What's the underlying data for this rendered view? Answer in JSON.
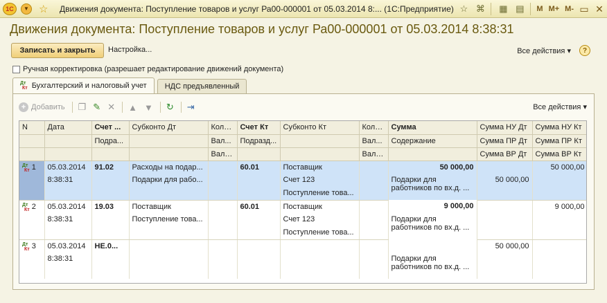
{
  "window": {
    "title": "Движения документа: Поступление товаров и услуг Ра00-000001 от 05.03.2014 8:... (1С:Предприятие)",
    "logo_text": "1С",
    "tb_m": "M",
    "tb_mplus": "M+",
    "tb_mminus": "M-"
  },
  "form": {
    "title": "Движения документа: Поступление товаров и услуг Ра00-000001 от 05.03.2014 8:38:31",
    "save_close_label": "Записать и закрыть",
    "settings_label": "Настройка...",
    "all_actions_label": "Все действия",
    "help_label": "?",
    "manual_adjust_label": "Ручная корректировка (разрешает редактирование движений документа)"
  },
  "tabs": [
    {
      "label": "Бухгалтерский и налоговый учет"
    },
    {
      "label": "НДС предъявленный"
    }
  ],
  "toolbar": {
    "add_label": "Добавить",
    "all_actions_label": "Все действия"
  },
  "table": {
    "headers": {
      "row1": [
        "N",
        "Дата",
        "Счет ...",
        "Субконто Дт",
        "Коли...",
        "Счет Кт",
        "Субконто Кт",
        "Коли...",
        "Сумма",
        "Сумма НУ Дт",
        "Сумма НУ Кт"
      ],
      "row2": [
        "",
        "",
        "Подра...",
        "",
        "Вал...",
        "Подразд...",
        "",
        "Вал...",
        "Содержание",
        "Сумма ПР Дт",
        "Сумма ПР Кт"
      ],
      "row3": [
        "",
        "",
        "",
        "",
        "Вал. ...",
        "",
        "",
        "Вал. ...",
        "",
        "Сумма ВР Дт",
        "Сумма ВР Кт"
      ]
    },
    "rows": [
      {
        "n": "1",
        "date": "05.03.2014",
        "time": "8:38:31",
        "account_dt": "91.02",
        "subconto_dt_1": "Расходы на подар...",
        "subconto_dt_2": "Подарки для рабо...",
        "account_kt": "60.01",
        "subconto_kt_1": "Поставщик",
        "subconto_kt_2": "Счет 123",
        "subconto_kt_3": "Поступление това...",
        "sum": "50 000,00",
        "content": "Подарки для работников по вх.д. ...",
        "nu_dt": "",
        "nu_kt": "50 000,00",
        "pr_dt": "50 000,00",
        "pr_kt": "",
        "vr_dt": "",
        "vr_kt": ""
      },
      {
        "n": "2",
        "date": "05.03.2014",
        "time": "8:38:31",
        "account_dt": "19.03",
        "subconto_dt_1": "Поставщик",
        "subconto_dt_2": "Поступление това...",
        "account_kt": "60.01",
        "subconto_kt_1": "Поставщик",
        "subconto_kt_2": "Счет 123",
        "subconto_kt_3": "Поступление това...",
        "sum": "9 000,00",
        "content": "Подарки для работников по вх.д. ...",
        "nu_dt": "",
        "nu_kt": "9 000,00",
        "pr_dt": "",
        "pr_kt": "",
        "vr_dt": "",
        "vr_kt": ""
      },
      {
        "n": "3",
        "date": "05.03.2014",
        "time": "8:38:31",
        "account_dt": "НЕ.0...",
        "subconto_dt_1": "",
        "subconto_dt_2": "",
        "account_kt": "",
        "subconto_kt_1": "",
        "subconto_kt_2": "",
        "subconto_kt_3": "",
        "sum": "",
        "content": "Подарки для работников по вх.д. ...",
        "nu_dt": "50 000,00",
        "nu_kt": "",
        "pr_dt": "",
        "pr_kt": "",
        "vr_dt": "",
        "vr_kt": ""
      }
    ]
  },
  "colors": {
    "title_text": "#6a5a10",
    "selected_row": "#cfe3f8",
    "header_bg": "#f1eedd"
  }
}
